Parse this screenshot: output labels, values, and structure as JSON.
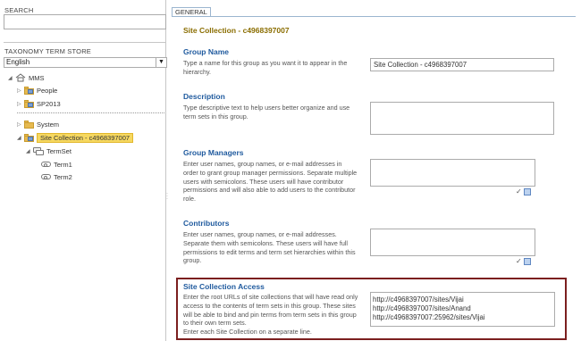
{
  "left": {
    "search_label": "SEARCH",
    "store_label": "TAXONOMY TERM STORE",
    "language": "English",
    "tree": {
      "mms": "MMS",
      "people": "People",
      "sp2013": "SP2013",
      "system": "System",
      "site_collection": "Site Collection - c4968397007",
      "termset": "TermSet",
      "term1": "Term1",
      "term2": "Term2"
    }
  },
  "tab": "GENERAL",
  "title": "Site Collection - c4968397007",
  "group_name": {
    "heading": "Group Name",
    "desc": "Type a name for this group as you want it to appear in the hierarchy.",
    "value": "Site Collection - c4968397007"
  },
  "description": {
    "heading": "Description",
    "desc": "Type descriptive text to help users better organize and use term sets in this group.",
    "value": ""
  },
  "group_managers": {
    "heading": "Group Managers",
    "desc": "Enter user names, group names, or e-mail addresses in order to grant group manager permissions. Separate multiple users with semicolons. These users will have contributor permissions and will also able to add users to the contributor role.",
    "value": ""
  },
  "contributors": {
    "heading": "Contributors",
    "desc": "Enter user names, group names, or e-mail addresses. Separate them with semicolons. These users will have full permissions to edit terms and term set hierarchies within this group.",
    "value": ""
  },
  "site_collection_access": {
    "heading": "Site Collection Access",
    "desc": "Enter the root URLs of site collections that will have read only access to the contents of term sets in this group. These sites will be able to bind and pin terms from term sets in this group to their own term sets.",
    "desc2": "Enter each Site Collection on a separate line.",
    "urls": [
      "http://c4968397007/sites/Vijai",
      "http://c4968397007/sites/Anand",
      "http://c4968397007:25962/sites/Vijai"
    ]
  },
  "colors": {
    "heading": "#1f5a9e",
    "title": "#8a6d00",
    "highlight": "#7b1f1f",
    "selected": "#f6d860"
  }
}
